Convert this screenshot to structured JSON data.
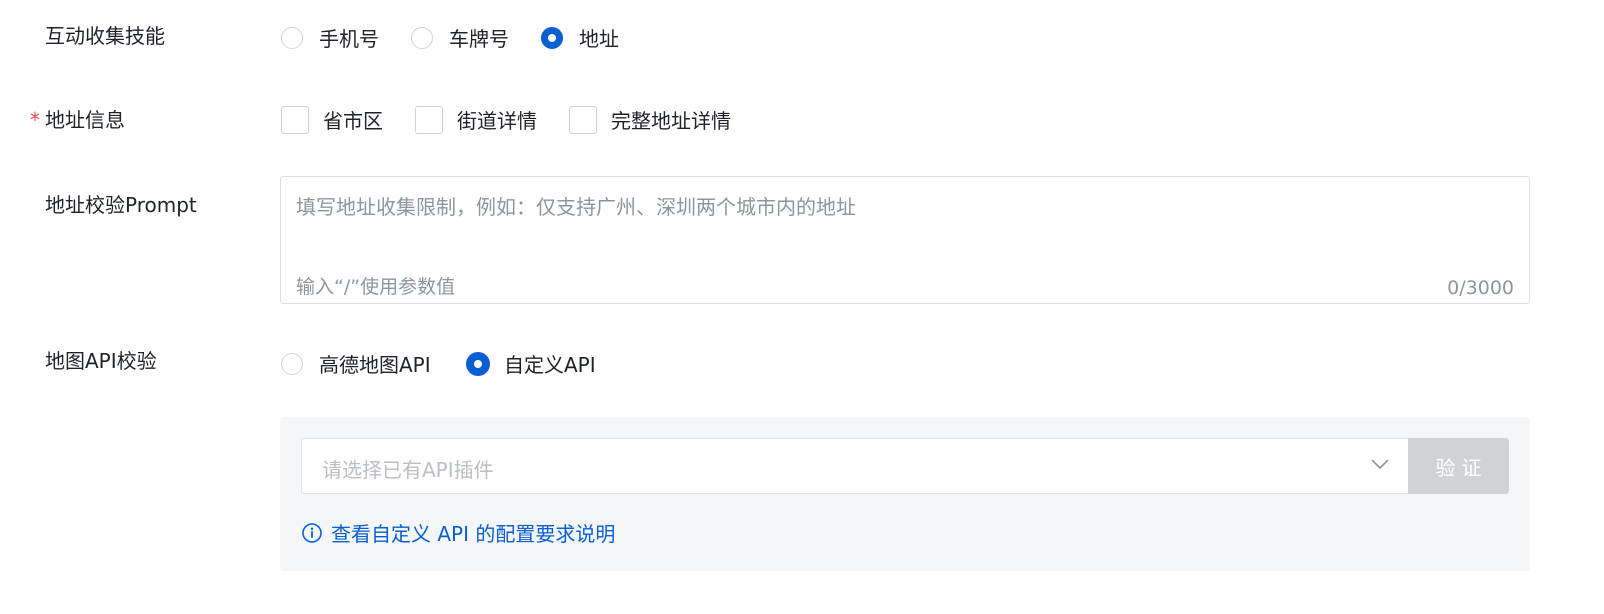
{
  "skill": {
    "label": "互动收集技能",
    "options": [
      "手机号",
      "车牌号",
      "地址"
    ],
    "selected": "地址"
  },
  "address_info": {
    "required_mark": "*",
    "label": "地址信息",
    "options": [
      "省市区",
      "街道详情",
      "完整地址详情"
    ]
  },
  "prompt": {
    "label": "地址校验Prompt",
    "placeholder": "填写地址收集限制，例如：仅支持广州、深圳两个城市内的地址",
    "hint": "输入“/”使用参数值",
    "counter": "0/3000"
  },
  "map_api": {
    "label": "地图API校验",
    "options": [
      "高德地图API",
      "自定义API"
    ],
    "selected": "自定义API"
  },
  "api_panel": {
    "select_placeholder": "请选择已有API插件",
    "verify_label": "验证",
    "help_link": "查看自定义 API 的配置要求说明"
  },
  "colors": {
    "primary": "#0a5fd0",
    "required": "#f54a45",
    "disabled_button": "#d0d3d6",
    "panel_bg": "#f5f6f7"
  },
  "icons": [
    "chevron-down-icon",
    "info-circle-icon"
  ]
}
